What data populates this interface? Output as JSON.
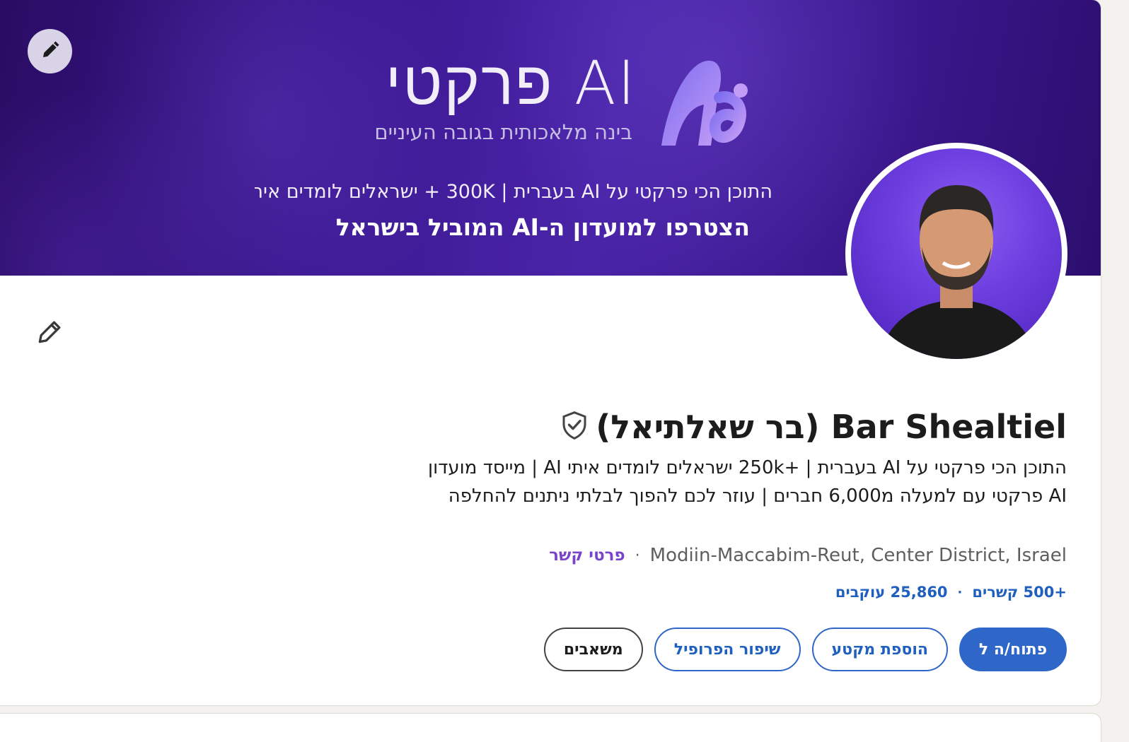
{
  "banner": {
    "brand_title": "AI פרקטי",
    "brand_subtitle": "בינה מלאכותית בגובה העיניים",
    "line1": "התוכן הכי פרקטי על AI בעברית | 300K + ישראלים לומדים איתי",
    "line2": "הצטרפו למועדון ה-AI המוביל בישראל"
  },
  "profile": {
    "name": "Bar Shealtiel (בר שאלתיאל)",
    "headline": "התוכן הכי פרקטי על AI בעברית | +250k ישראלים לומדים איתי AI | מייסד מועדון AI פרקטי עם למעלה מ6,000 חברים | עוזר לכם להפוך לבלתי ניתנים להחלפה",
    "location": "Modiin-Maccabim-Reut, Center District, Israel",
    "contact_info": "פרטי קשר",
    "followers": "25,860 עוקבים",
    "connections": "+500 קשרים"
  },
  "actions": {
    "open_to": "פתוח/ה ל",
    "add_section": "הוספת מקטע",
    "enhance_profile": "שיפור הפרופיל",
    "resources": "משאבים"
  },
  "icons": {
    "edit_banner": "pencil-icon",
    "edit_profile": "pencil-icon",
    "verified": "shield-check-icon"
  },
  "colors": {
    "primary": "#2f67c9",
    "link": "#1f5fbd",
    "contact": "#7a44c9",
    "banner": "#3a1790"
  }
}
